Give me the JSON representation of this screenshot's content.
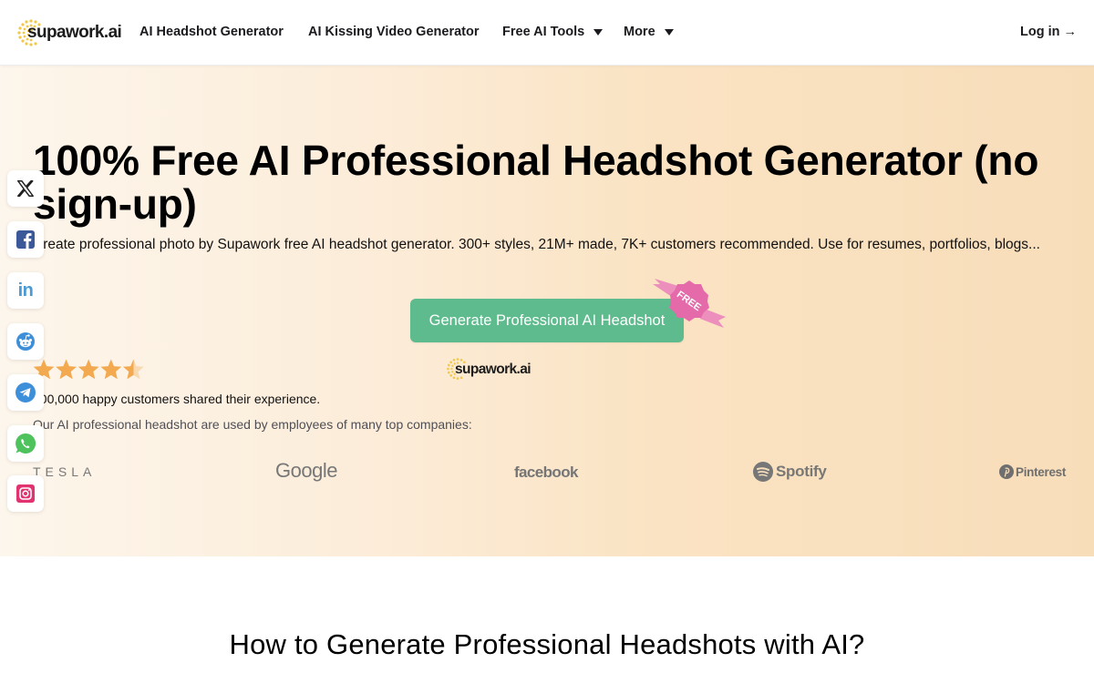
{
  "header": {
    "logo_text": "supawork.ai",
    "nav": [
      {
        "label": "AI Headshot Generator",
        "has_dropdown": false
      },
      {
        "label": "AI Kissing Video Generator",
        "has_dropdown": false
      },
      {
        "label": "Free AI Tools",
        "has_dropdown": true
      },
      {
        "label": "More",
        "has_dropdown": true
      }
    ],
    "login_label": "Log in →"
  },
  "hero": {
    "title": "100% Free AI Professional Headshot Generator (no sign-up)",
    "subtitle": "Create professional photo by Supawork free AI headshot generator. 300+ styles, 21M+ made, 7K+ customers recommended. Use for resumes, portfolios, blogs...",
    "cta_label": "Generate Professional AI Headshot",
    "badge_label": "FREE",
    "rating": 4.5,
    "rating_max": 5,
    "brand_logo_text": "supawork.ai",
    "happy_customers": "100,000 happy customers shared their experience.",
    "companies_intro": "Our AI professional headshot are used by employees of many top companies:",
    "companies": [
      "TESLA",
      "Google",
      "facebook",
      "Spotify",
      "Pinterest"
    ]
  },
  "social_share": [
    {
      "name": "x",
      "icon": "x-icon",
      "color": "#222222"
    },
    {
      "name": "facebook",
      "icon": "facebook-icon",
      "color": "#3b5998"
    },
    {
      "name": "linkedin",
      "icon": "linkedin-icon",
      "color": "#4a9ad4"
    },
    {
      "name": "reddit",
      "icon": "reddit-icon",
      "color": "#3d8fd9"
    },
    {
      "name": "telegram",
      "icon": "telegram-icon",
      "color": "#3d8fd9"
    },
    {
      "name": "whatsapp",
      "icon": "whatsapp-icon",
      "color": "#4ec25c"
    },
    {
      "name": "instagram",
      "icon": "instagram-icon",
      "color": "#e0336f"
    }
  ],
  "colors": {
    "cta": "#5dbb8d",
    "badge": "#e56aaa",
    "star": "#f3a94f"
  },
  "section2": {
    "title": "How to Generate Professional Headshots with AI?"
  }
}
